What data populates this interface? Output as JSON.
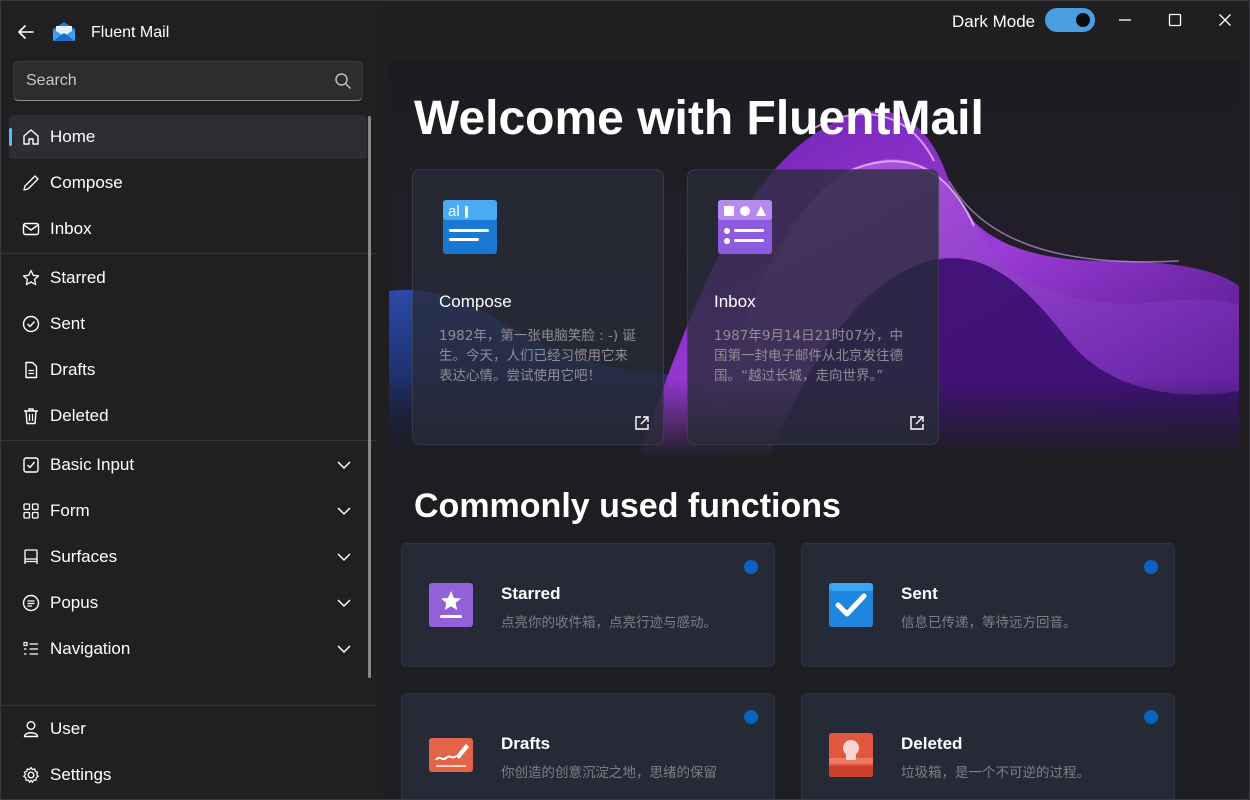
{
  "app": {
    "title": "Fluent Mail"
  },
  "search": {
    "placeholder": "Search"
  },
  "titlebar": {
    "dark_mode_label": "Dark Mode",
    "dark_mode_on": true
  },
  "sidebar": {
    "group1": [
      {
        "label": "Home",
        "icon": "home-icon",
        "active": true
      },
      {
        "label": "Compose",
        "icon": "pencil-icon"
      },
      {
        "label": "Inbox",
        "icon": "mail-icon"
      }
    ],
    "group2": [
      {
        "label": "Starred",
        "icon": "star-icon"
      },
      {
        "label": "Sent",
        "icon": "check-circle-icon"
      },
      {
        "label": "Drafts",
        "icon": "document-icon"
      },
      {
        "label": "Deleted",
        "icon": "trash-icon"
      }
    ],
    "group3": [
      {
        "label": "Basic Input",
        "icon": "checkbox-icon"
      },
      {
        "label": "Form",
        "icon": "grid-icon"
      },
      {
        "label": "Surfaces",
        "icon": "easel-icon"
      },
      {
        "label": "Popus",
        "icon": "list-circle-icon"
      },
      {
        "label": "Navigation",
        "icon": "list-icon"
      }
    ],
    "bottom": [
      {
        "label": "User",
        "icon": "person-icon"
      },
      {
        "label": "Settings",
        "icon": "gear-icon"
      }
    ]
  },
  "hero": {
    "title": "Welcome with FluentMail",
    "cards": [
      {
        "title": "Compose",
        "desc": "1982年，第一张电脑笑脸 : -) 诞生。今天，人们已经习惯用它来表达心情。尝试使用它吧！",
        "icon": "compose-app-icon"
      },
      {
        "title": "Inbox",
        "desc": "1987年9月14日21时07分，中国第一封电子邮件从北京发往德国。“越过长城，走向世界。”",
        "icon": "inbox-app-icon"
      }
    ]
  },
  "functions": {
    "title": "Commonly used functions",
    "cards": [
      {
        "title": "Starred",
        "desc": "点亮你的收件箱，点亮行迹与感动。",
        "icon": "starred-app-icon"
      },
      {
        "title": "Sent",
        "desc": "信息已传递，等待远方回音。",
        "icon": "sent-app-icon"
      },
      {
        "title": "Drafts",
        "desc": "你创造的创意沉淀之地，思绪的保留",
        "icon": "drafts-app-icon"
      },
      {
        "title": "Deleted",
        "desc": "垃圾箱，是一个不可逆的过程。",
        "icon": "deleted-app-icon"
      }
    ]
  },
  "colors": {
    "accent": "#4cc2ff",
    "toggle": "#4a9de0",
    "dot": "#0a62c0"
  }
}
